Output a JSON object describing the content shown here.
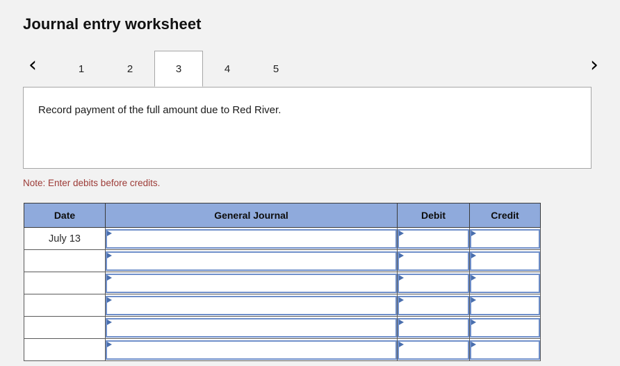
{
  "page": {
    "title": "Journal entry worksheet",
    "background_color": "#f2f2f2"
  },
  "tabs": {
    "prev_label": "‹",
    "next_label": "›",
    "prev_icon": "chevron-left-icon",
    "next_icon": "chevron-right-icon",
    "active_index": 2,
    "items": [
      {
        "label": "1"
      },
      {
        "label": "2"
      },
      {
        "label": "3"
      },
      {
        "label": "4"
      },
      {
        "label": "5"
      }
    ]
  },
  "prompt": {
    "text": "Record payment of the full amount due to Red River."
  },
  "note": {
    "text": "Note: Enter debits before credits.",
    "color": "#9c3a36"
  },
  "table": {
    "header_color": "#8faadc",
    "columns": [
      {
        "key": "date",
        "label": "Date"
      },
      {
        "key": "journal",
        "label": "General Journal"
      },
      {
        "key": "debit",
        "label": "Debit"
      },
      {
        "key": "credit",
        "label": "Credit"
      }
    ],
    "rows": [
      {
        "date": "July 13",
        "journal": "",
        "debit": "",
        "credit": ""
      },
      {
        "date": "",
        "journal": "",
        "debit": "",
        "credit": ""
      },
      {
        "date": "",
        "journal": "",
        "debit": "",
        "credit": ""
      },
      {
        "date": "",
        "journal": "",
        "debit": "",
        "credit": ""
      },
      {
        "date": "",
        "journal": "",
        "debit": "",
        "credit": ""
      },
      {
        "date": "",
        "journal": "",
        "debit": "",
        "credit": ""
      }
    ]
  }
}
